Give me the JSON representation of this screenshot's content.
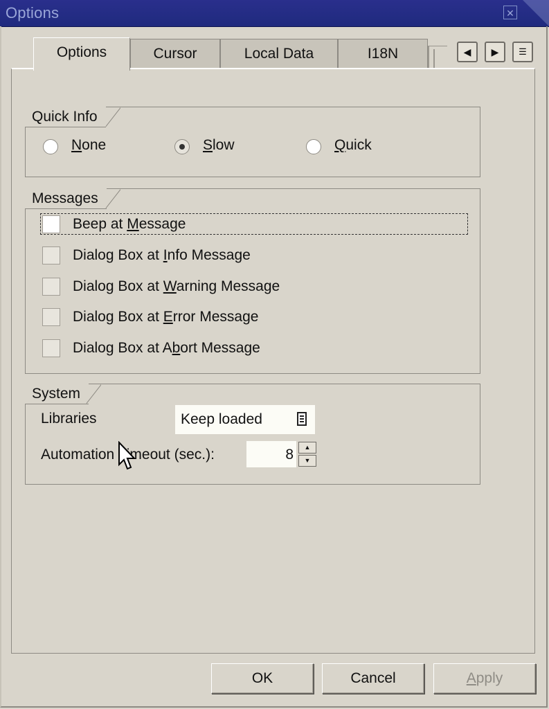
{
  "window": {
    "title": "Options",
    "close_icon": "close-icon"
  },
  "tabs": [
    {
      "label": "Options",
      "active": true
    },
    {
      "label": "Cursor",
      "active": false
    },
    {
      "label": "Local Data",
      "active": false
    },
    {
      "label": "I18N",
      "active": false
    }
  ],
  "tab_nav": {
    "prev_icon": "triangle-left-icon",
    "next_icon": "triangle-right-icon",
    "list_icon": "tab-list-icon"
  },
  "quick_info": {
    "title": "Quick Info",
    "options": [
      {
        "label": "None",
        "mnemonic": "N",
        "selected": false
      },
      {
        "label": "Slow",
        "mnemonic": "S",
        "selected": true
      },
      {
        "label": "Quick",
        "mnemonic": "Q",
        "selected": false
      }
    ]
  },
  "messages": {
    "title": "Messages",
    "items": [
      {
        "label": "Beep at Message",
        "checked": false
      },
      {
        "label": "Dialog Box at Info Message",
        "checked": false
      },
      {
        "label": "Dialog Box at Warning Message",
        "checked": false
      },
      {
        "label": "Dialog Box at Error Message",
        "checked": false
      },
      {
        "label": "Dialog Box at Abort Message",
        "checked": false
      }
    ]
  },
  "system": {
    "title": "System",
    "libraries_label": "Libraries",
    "libraries_value": "Keep loaded",
    "timeout_label": "Automation Timeout (sec.):",
    "timeout_value": "8"
  },
  "buttons": {
    "ok": "OK",
    "cancel": "Cancel",
    "apply": "Apply"
  },
  "colors": {
    "title_bar": "#1f2a7e",
    "dialog_bg": "#d9d5cb"
  }
}
